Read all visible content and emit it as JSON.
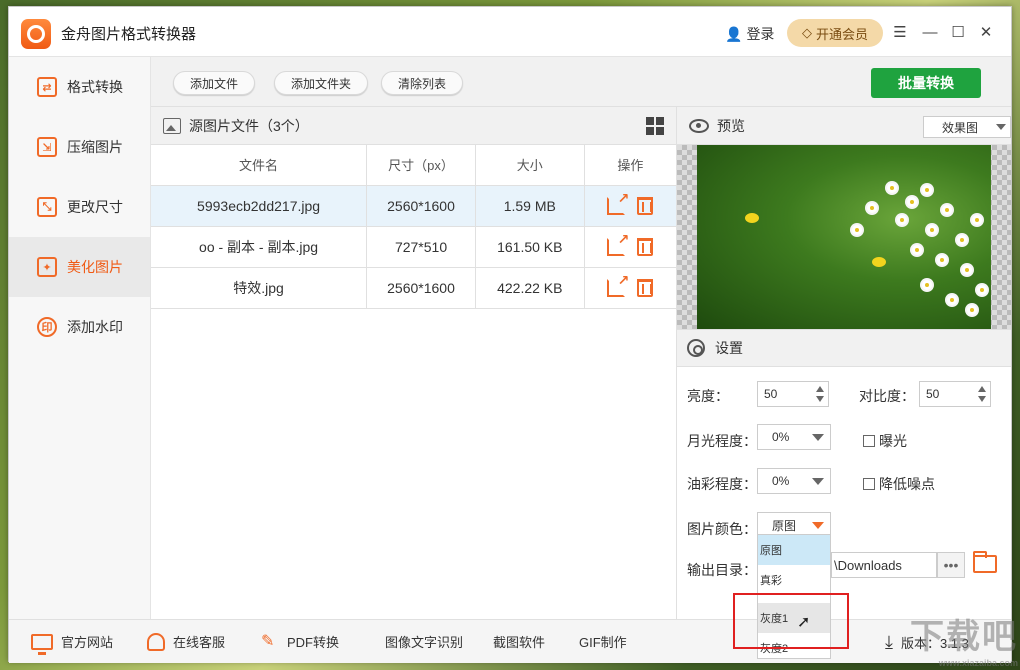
{
  "app": {
    "title": "金舟图片格式转换器",
    "login": "登录",
    "vip": "开通会员",
    "win_min": "☰",
    "win_minimize": "—",
    "win_max": "☐",
    "win_close": "✕"
  },
  "sidebar": {
    "items": [
      {
        "label": "格式转换",
        "icon": "swap-icon",
        "glyph": "⇄"
      },
      {
        "label": "压缩图片",
        "icon": "compress-icon",
        "glyph": "⇲"
      },
      {
        "label": "更改尺寸",
        "icon": "resize-icon",
        "glyph": "⤡"
      },
      {
        "label": "美化图片",
        "icon": "beautify-icon",
        "glyph": "✦"
      },
      {
        "label": "添加水印",
        "icon": "watermark-icon",
        "glyph": "印"
      }
    ],
    "active_index": 3
  },
  "toolbar": {
    "add_file": "添加文件",
    "add_folder": "添加文件夹",
    "clear_list": "清除列表",
    "batch_convert": "批量转换"
  },
  "files": {
    "header": "源图片文件（3个）",
    "columns": [
      "文件名",
      "尺寸（px）",
      "大小",
      "操作"
    ],
    "rows": [
      {
        "name": "5993ecb2dd217.jpg",
        "dim": "2560*1600",
        "size": "1.59 MB",
        "selected": true
      },
      {
        "name": "oo - 副本 - 副本.jpg",
        "dim": "727*510",
        "size": "161.50 KB",
        "selected": false
      },
      {
        "name": "特效.jpg",
        "dim": "2560*1600",
        "size": "422.22 KB",
        "selected": false
      }
    ]
  },
  "preview": {
    "title": "预览",
    "mode": "效果图"
  },
  "settings": {
    "title": "设置",
    "brightness_label": "亮度：",
    "brightness": "50",
    "contrast_label": "对比度：",
    "contrast": "50",
    "moonlight_label": "月光程度：",
    "moonlight": "0%",
    "exposure_label": "曝光",
    "oil_label": "油彩程度：",
    "oil": "0%",
    "denoise_label": "降低噪点",
    "color_label": "图片颜色：",
    "color": "原图",
    "color_options": [
      "原图",
      "真彩",
      "灰度1",
      "灰度2"
    ],
    "output_label": "输出目录：",
    "output_path": "\\Downloads",
    "browse": "•••"
  },
  "footer": {
    "website": "官方网站",
    "support": "在线客服",
    "pdf": "PDF转换",
    "ocr": "图像文字识别",
    "screenshot": "截图软件",
    "gif": "GIF制作",
    "version": "版本：3.1.3"
  },
  "watermark": {
    "text": "下载吧",
    "sub": "www.xiazaiba.com"
  }
}
